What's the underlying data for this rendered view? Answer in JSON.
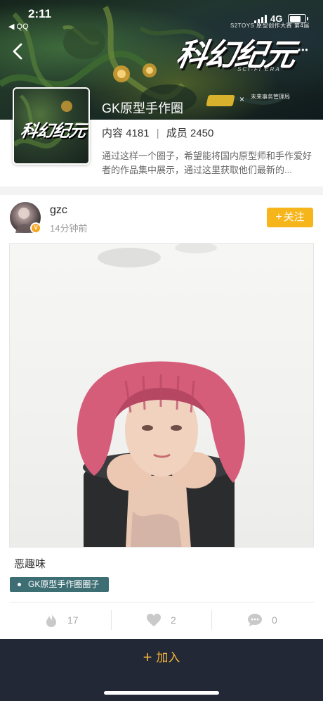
{
  "status_bar": {
    "time": "2:11",
    "back_app": "◀ QQ",
    "network": "4G",
    "battery_level": 0.75
  },
  "banner": {
    "sponsor_text": "S2TOYS 原型创作大赛 第4届",
    "logo_text": "科幻纪元",
    "logo_subtitle": "SCI-FI ERA",
    "partner_cross": "×",
    "partner_name": "未来事务管理局",
    "more_icon": "•••"
  },
  "circle": {
    "title": "GK原型手作圈",
    "avatar_logo": "科幻纪元",
    "content_label": "内容",
    "content_count": "4181",
    "member_label": "成员",
    "member_count": "2450",
    "stats_separator": "|",
    "description": "通过这样一个圈子，希望能将国内原型师和手作爱好者的作品集中展示，通过这里获取他们最新的..."
  },
  "post": {
    "username": "gzc",
    "time_ago": "14分钟前",
    "verify_badge": "V",
    "follow_label": "关注",
    "follow_plus": "+",
    "text": "恶趣味",
    "tag": "GK原型手作圈圈子",
    "likes": "17",
    "hearts": "2",
    "comments": "0"
  },
  "join": {
    "plus": "+",
    "label": "加入"
  },
  "colors": {
    "accent": "#f7b51c",
    "tag_bg": "#3d6e74",
    "bottom_bar": "#232836"
  }
}
